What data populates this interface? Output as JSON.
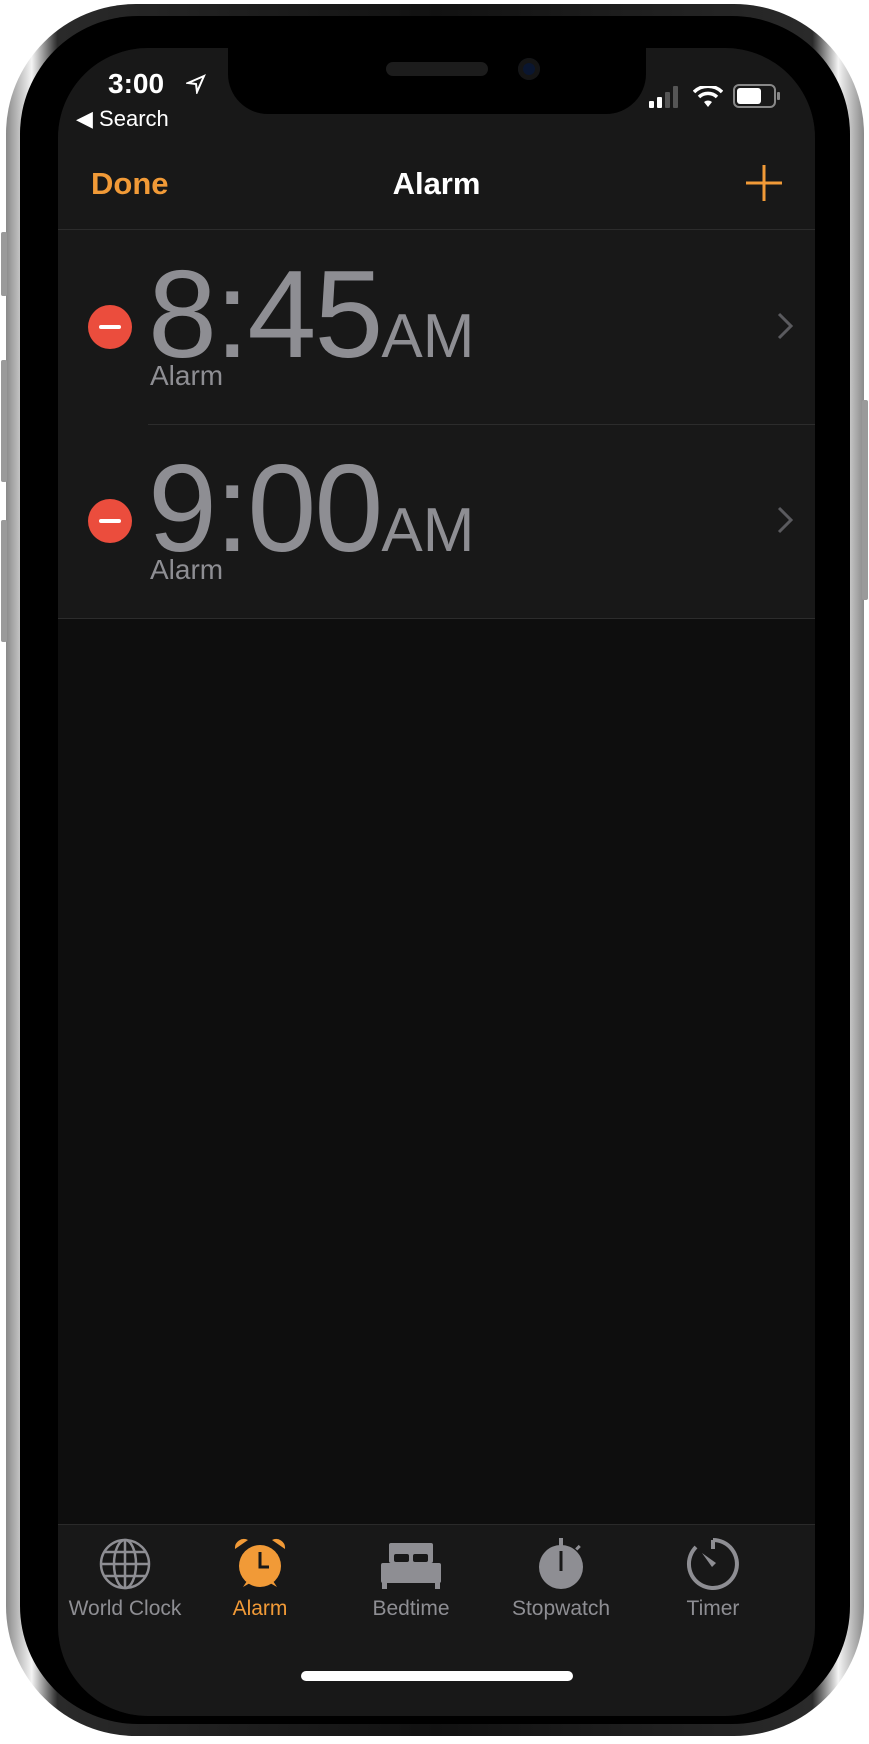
{
  "status": {
    "time": "3:00",
    "back_label": "Search"
  },
  "nav": {
    "done_label": "Done",
    "title": "Alarm",
    "add_icon": "plus-icon"
  },
  "alarms": [
    {
      "hours_minutes": "8:45",
      "period": "AM",
      "label": "Alarm"
    },
    {
      "hours_minutes": "9:00",
      "period": "AM",
      "label": "Alarm"
    }
  ],
  "tabs": [
    {
      "label": "World Clock",
      "icon": "globe-icon"
    },
    {
      "label": "Alarm",
      "icon": "alarm-clock-icon",
      "active": true
    },
    {
      "label": "Bedtime",
      "icon": "bed-icon"
    },
    {
      "label": "Stopwatch",
      "icon": "stopwatch-icon"
    },
    {
      "label": "Timer",
      "icon": "timer-icon"
    }
  ],
  "colors": {
    "accent": "#f19a37",
    "delete": "#eb4d3d",
    "secondary_text": "#8e8e93"
  }
}
